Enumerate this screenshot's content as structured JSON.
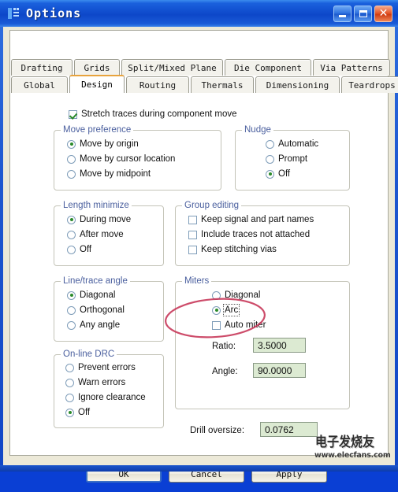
{
  "window": {
    "title": "Options",
    "icon": "pcb-options-icon",
    "controls": {
      "minimize": "minimize-icon",
      "maximize": "maximize-icon",
      "close": "close-icon"
    }
  },
  "tabs": {
    "row1": [
      {
        "label": "Drafting",
        "active": false
      },
      {
        "label": "Grids",
        "active": false
      },
      {
        "label": "Split/Mixed Plane",
        "active": false
      },
      {
        "label": "Die Component",
        "active": false
      },
      {
        "label": "Via Patterns",
        "active": false
      }
    ],
    "row2": [
      {
        "label": "Global",
        "active": false
      },
      {
        "label": "Design",
        "active": true
      },
      {
        "label": "Routing",
        "active": false
      },
      {
        "label": "Thermals",
        "active": false
      },
      {
        "label": "Dimensioning",
        "active": false
      },
      {
        "label": "Teardrops",
        "active": false
      }
    ]
  },
  "design": {
    "stretch_traces": {
      "label": "Stretch traces during component move",
      "checked": true
    },
    "move_preference": {
      "title": "Move preference",
      "options": [
        {
          "label": "Move by origin",
          "selected": true
        },
        {
          "label": "Move by cursor location",
          "selected": false
        },
        {
          "label": "Move by midpoint",
          "selected": false
        }
      ]
    },
    "nudge": {
      "title": "Nudge",
      "options": [
        {
          "label": "Automatic",
          "selected": false
        },
        {
          "label": "Prompt",
          "selected": false
        },
        {
          "label": "Off",
          "selected": true
        }
      ]
    },
    "length_minimize": {
      "title": "Length minimize",
      "options": [
        {
          "label": "During move",
          "selected": true
        },
        {
          "label": "After move",
          "selected": false
        },
        {
          "label": "Off",
          "selected": false
        }
      ]
    },
    "group_editing": {
      "title": "Group editing",
      "options": [
        {
          "label": "Keep signal and part names",
          "checked": false
        },
        {
          "label": "Include traces not attached",
          "checked": false
        },
        {
          "label": "Keep stitching vias",
          "checked": false
        }
      ]
    },
    "line_trace_angle": {
      "title": "Line/trace angle",
      "options": [
        {
          "label": "Diagonal",
          "selected": true
        },
        {
          "label": "Orthogonal",
          "selected": false
        },
        {
          "label": "Any angle",
          "selected": false
        }
      ]
    },
    "miters": {
      "title": "Miters",
      "options": [
        {
          "label": "Diagonal",
          "selected": false
        },
        {
          "label": "Arc",
          "selected": true,
          "focused": true
        }
      ],
      "auto_miter": {
        "label": "Auto miter",
        "checked": false
      },
      "ratio": {
        "label": "Ratio:",
        "value": "3.5000"
      },
      "angle": {
        "label": "Angle:",
        "value": "90.0000"
      }
    },
    "online_drc": {
      "title": "On-line DRC",
      "options": [
        {
          "label": "Prevent errors",
          "selected": false
        },
        {
          "label": "Warn errors",
          "selected": false
        },
        {
          "label": "Ignore clearance",
          "selected": false
        },
        {
          "label": "Off",
          "selected": true
        }
      ]
    },
    "drill_oversize": {
      "label": "Drill oversize:",
      "value": "0.0762"
    }
  },
  "buttons": {
    "ok": "OK",
    "cancel": "Cancel",
    "apply": "Apply"
  },
  "annotation": {
    "shape": "red-ellipse-highlight",
    "color": "#c8385a"
  },
  "watermark": {
    "text": "电子发烧友",
    "url": "www.elecfans.com"
  }
}
